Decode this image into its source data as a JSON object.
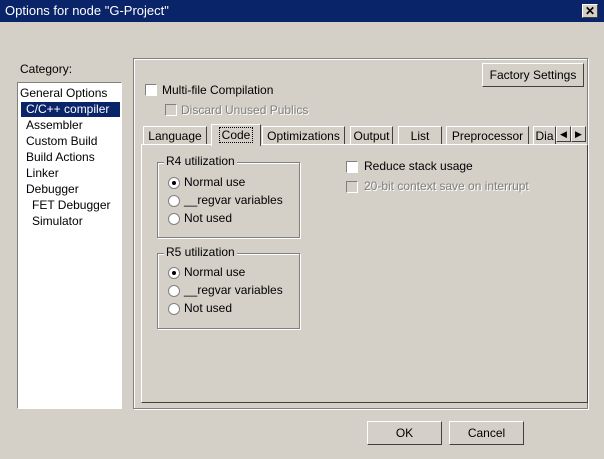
{
  "window": {
    "title": "Options for node \"G-Project\"",
    "close_glyph": "✕"
  },
  "category": {
    "label": "Category:",
    "items": [
      {
        "label": "General Options",
        "indent": 0,
        "selected": false
      },
      {
        "label": "C/C++ compiler",
        "indent": 1,
        "selected": true
      },
      {
        "label": "Assembler",
        "indent": 1,
        "selected": false
      },
      {
        "label": "Custom Build",
        "indent": 1,
        "selected": false
      },
      {
        "label": "Build Actions",
        "indent": 1,
        "selected": false
      },
      {
        "label": "Linker",
        "indent": 1,
        "selected": false
      },
      {
        "label": "Debugger",
        "indent": 1,
        "selected": false
      },
      {
        "label": "FET Debugger",
        "indent": 2,
        "selected": false
      },
      {
        "label": "Simulator",
        "indent": 2,
        "selected": false
      }
    ]
  },
  "options": {
    "factory_settings": "Factory Settings",
    "multi_file": {
      "label": "Multi-file Compilation",
      "checked": false
    },
    "discard_unused": {
      "label": "Discard Unused Publics",
      "checked": false,
      "enabled": false
    }
  },
  "tabs": [
    {
      "label": "Language",
      "active": false
    },
    {
      "label": "Code",
      "active": true
    },
    {
      "label": "Optimizations",
      "active": false
    },
    {
      "label": "Output",
      "active": false
    },
    {
      "label": "List",
      "active": false
    },
    {
      "label": "Preprocessor",
      "active": false
    },
    {
      "label": "Dia",
      "active": false
    }
  ],
  "tab_scroll": {
    "left": "◀",
    "right": "▶"
  },
  "code": {
    "r4": {
      "legend": "R4 utilization",
      "options": [
        {
          "label": "Normal use",
          "selected": true
        },
        {
          "label": "__regvar variables",
          "selected": false
        },
        {
          "label": "Not used",
          "selected": false
        }
      ]
    },
    "r5": {
      "legend": "R5 utilization",
      "options": [
        {
          "label": "Normal use",
          "selected": true
        },
        {
          "label": "__regvar variables",
          "selected": false
        },
        {
          "label": "Not used",
          "selected": false
        }
      ]
    },
    "reduce_stack": {
      "label": "Reduce stack usage",
      "checked": false,
      "enabled": true
    },
    "context_save": {
      "label": "20-bit context save on interrupt",
      "checked": false,
      "enabled": false
    }
  },
  "footer": {
    "ok": "OK",
    "cancel": "Cancel"
  }
}
